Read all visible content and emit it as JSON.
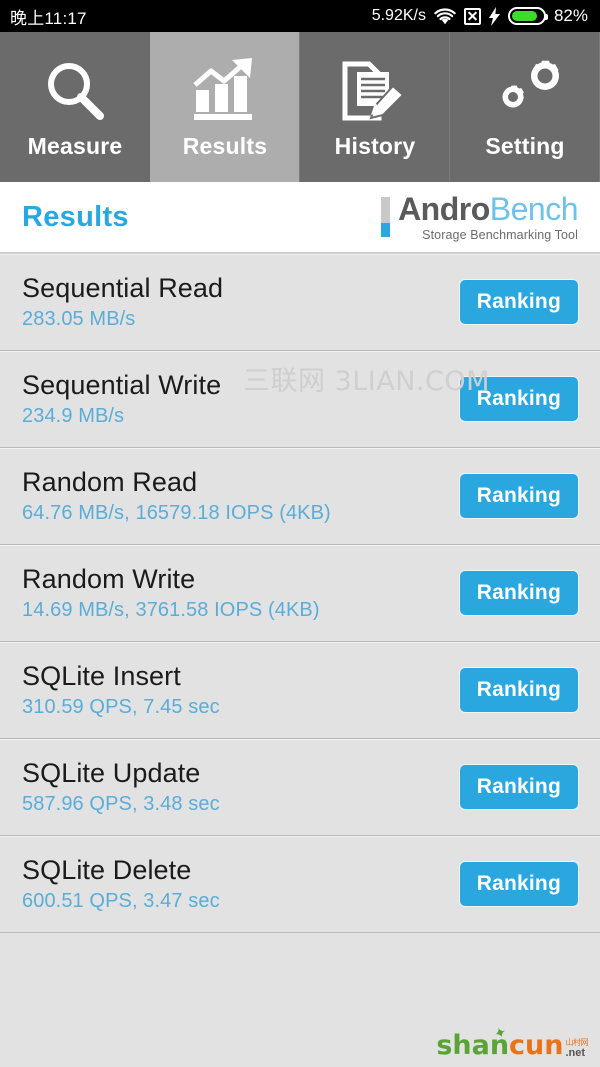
{
  "status_bar": {
    "time": "晚上11:17",
    "network_speed": "5.92K/s",
    "wifi_icon": "wifi-icon",
    "nosim_icon": "no-sim-icon",
    "charging_icon": "charging-bolt-icon",
    "battery_icon": "battery-icon",
    "battery_level": "82%",
    "battery_percent": 82,
    "battery_color": "#3ddc2b"
  },
  "tabs": [
    {
      "label": "Measure",
      "icon": "magnifier-icon",
      "active": false
    },
    {
      "label": "Results",
      "icon": "bar-chart-arrow-icon",
      "active": true
    },
    {
      "label": "History",
      "icon": "document-pencil-icon",
      "active": false
    },
    {
      "label": "Setting",
      "icon": "gears-icon",
      "active": false
    }
  ],
  "header": {
    "title": "Results",
    "title_color": "#2ba7e0",
    "brand_first": "Andro",
    "brand_second": "Bench",
    "brand_subtitle": "Storage Benchmarking Tool"
  },
  "results": {
    "button_label": "Ranking",
    "accent_color": "#2ba7e0",
    "value_color": "#5aadd8",
    "rows": [
      {
        "title": "Sequential Read",
        "value": "283.05 MB/s"
      },
      {
        "title": "Sequential Write",
        "value": "234.9 MB/s"
      },
      {
        "title": "Random Read",
        "value": "64.76 MB/s, 16579.18 IOPS (4KB)"
      },
      {
        "title": "Random Write",
        "value": "14.69 MB/s, 3761.58 IOPS (4KB)"
      },
      {
        "title": "SQLite Insert",
        "value": "310.59 QPS, 7.45 sec"
      },
      {
        "title": "SQLite Update",
        "value": "587.96 QPS, 3.48 sec"
      },
      {
        "title": "SQLite Delete",
        "value": "600.51 QPS, 3.47 sec"
      }
    ]
  },
  "watermarks": {
    "overlay_text": "三联网 3LIAN.COM",
    "logo_shan": "shan",
    "logo_cun": "cun",
    "logo_cn": "山村网",
    "logo_net": ".net"
  }
}
